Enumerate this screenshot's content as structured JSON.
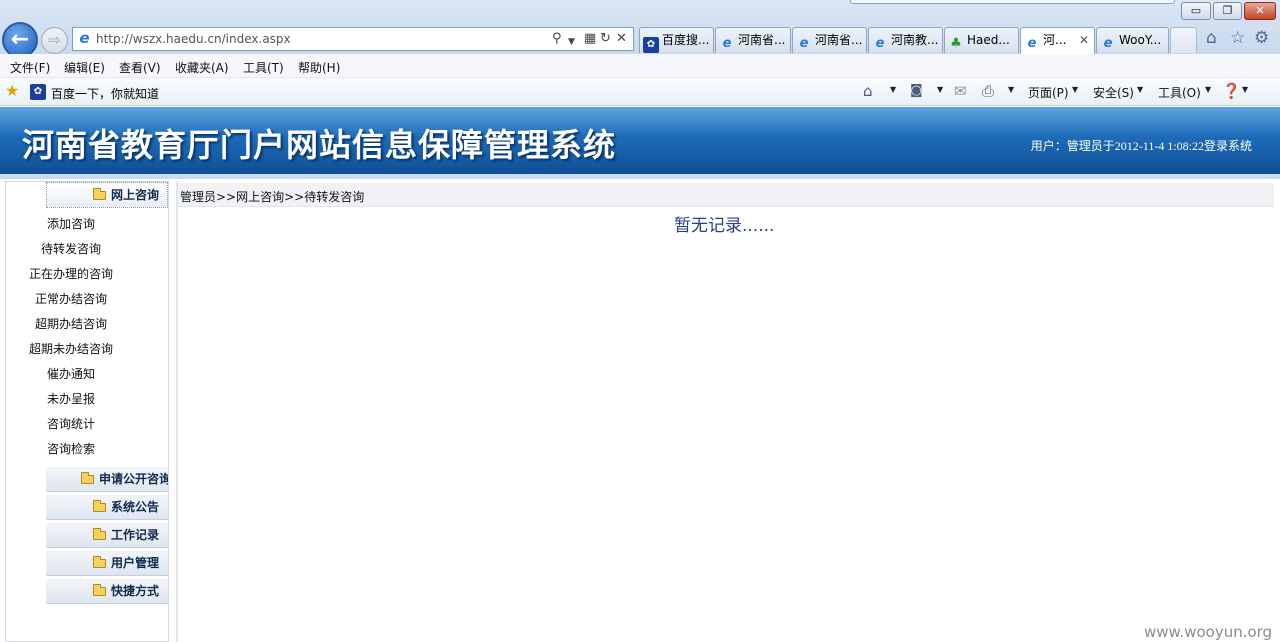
{
  "window": {
    "min_glyph": "▭",
    "restore_glyph": "❐",
    "close_glyph": "✕"
  },
  "nav": {
    "back_glyph": "←",
    "forward_glyph": "⇨"
  },
  "address": {
    "url": "http://wszx.haedu.cn/index.aspx",
    "icon": "ie-icon",
    "tools": [
      "search-icon",
      "compat-icon",
      "refresh-icon",
      "stop-icon"
    ]
  },
  "tabs": [
    {
      "label": "百度搜...",
      "icon": "baidu-paw-icon",
      "active": false
    },
    {
      "label": "河南省...",
      "icon": "ie-icon",
      "active": false
    },
    {
      "label": "河南省...",
      "icon": "ie-icon",
      "active": false
    },
    {
      "label": "河南教...",
      "icon": "ie-icon",
      "active": false
    },
    {
      "label": "Haed...",
      "icon": "clover-icon",
      "active": false
    },
    {
      "label": "河...",
      "icon": "ie-icon",
      "active": true
    },
    {
      "label": "WooY...",
      "icon": "ie-icon",
      "active": false
    }
  ],
  "menu": [
    "文件(F)",
    "编辑(E)",
    "查看(V)",
    "收藏夹(A)",
    "工具(T)",
    "帮助(H)"
  ],
  "favorites": {
    "link": "百度一下，你就知道"
  },
  "command_bar": {
    "page": "页面(P)",
    "safety": "安全(S)",
    "tools": "工具(O)"
  },
  "banner": {
    "title": "河南省教育厅门户网站信息保障管理系统",
    "user_line": "用户：管理员于2012-11-4 1:08:22登录系统"
  },
  "sidebar": {
    "open_section": "网上咨询",
    "items": [
      "添加咨询",
      "待转发咨询",
      "正在办理的咨询",
      "正常办结咨询",
      "超期办结咨询",
      "超期未办结咨询",
      "催办通知",
      "未办呈报",
      "咨询统计",
      "咨询检索"
    ],
    "sections": [
      "申请公开咨询",
      "系统公告",
      "工作记录",
      "用户管理",
      "快捷方式"
    ]
  },
  "content": {
    "breadcrumb": "管理员>>网上咨询>>待转发咨询",
    "empty_message": "暂无记录......"
  },
  "watermark": "www.wooyun.org",
  "colors": {
    "banner": "#1d6bb8",
    "empty_text": "#2b3d8f"
  }
}
